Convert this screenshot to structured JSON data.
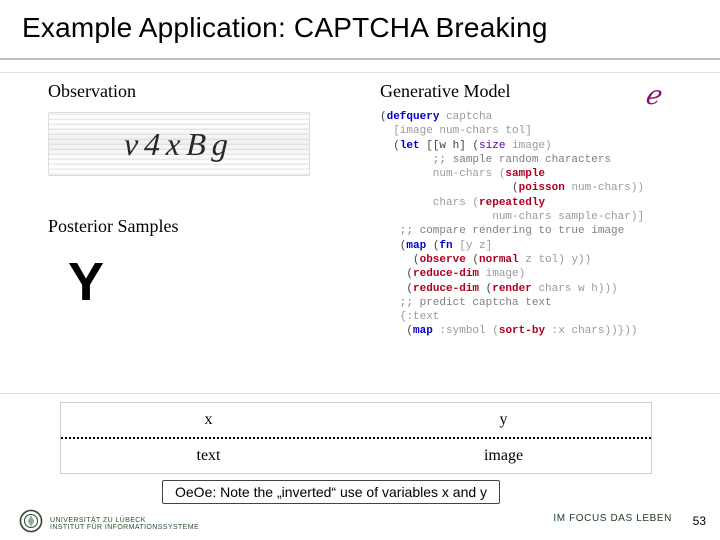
{
  "title": "Example Application: CAPTCHA Breaking",
  "left": {
    "observation_heading": "Observation",
    "captcha_text": "v4xBg",
    "posterior_heading": "Posterior Samples",
    "posterior_sample": "Y"
  },
  "right": {
    "generative_heading": "Generative Model",
    "logo_glyph": "ℯ",
    "code": {
      "l1a": "(",
      "l1b": "defquery",
      "l1c": " captcha",
      "l2": "  [image num-chars tol]",
      "l3a": "  (",
      "l3b": "let",
      "l3c": " [[w h] (",
      "l3d": "size",
      "l3e": " image)",
      "l4": "        ;; sample random characters",
      "l5a": "        num-chars (",
      "l5b": "sample",
      "l6a": "                    (",
      "l6b": "poisson",
      "l6c": " num-chars))",
      "l7a": "        chars (",
      "l7b": "repeatedly",
      "l8": "                 num-chars sample-char)]",
      "l9": "   ;; compare rendering to true image",
      "l10a": "   (",
      "l10b": "map",
      "l10c": " (",
      "l10d": "fn",
      "l10e": " [y z]",
      "l11a": "     (",
      "l11b": "observe",
      "l11c": " (",
      "l11d": "normal",
      "l11e": " z tol) y))",
      "l12a": "    (",
      "l12b": "reduce-dim",
      "l12c": " image)",
      "l13a": "    (",
      "l13b": "reduce-dim",
      "l13c": " (",
      "l13d": "render",
      "l13e": " chars w h)))",
      "l14": "   ;; predict captcha text",
      "l15": "   {:text",
      "l16a": "    (",
      "l16b": "map",
      "l16c": " :symbol (",
      "l16d": "sort-by",
      "l16e": " :x chars))}))"
    }
  },
  "xy": {
    "x": "x",
    "y": "y",
    "text": "text",
    "image": "image"
  },
  "note": "OeOe: Note the „inverted“ use of variables x and y",
  "footer": {
    "uni_line1": "UNIVERSITÄT ZU LÜBECK",
    "uni_line2": "INSTITUT FÜR INFORMATIONSSYSTEME",
    "motto": "IM FOCUS DAS LEBEN",
    "page": "53"
  }
}
